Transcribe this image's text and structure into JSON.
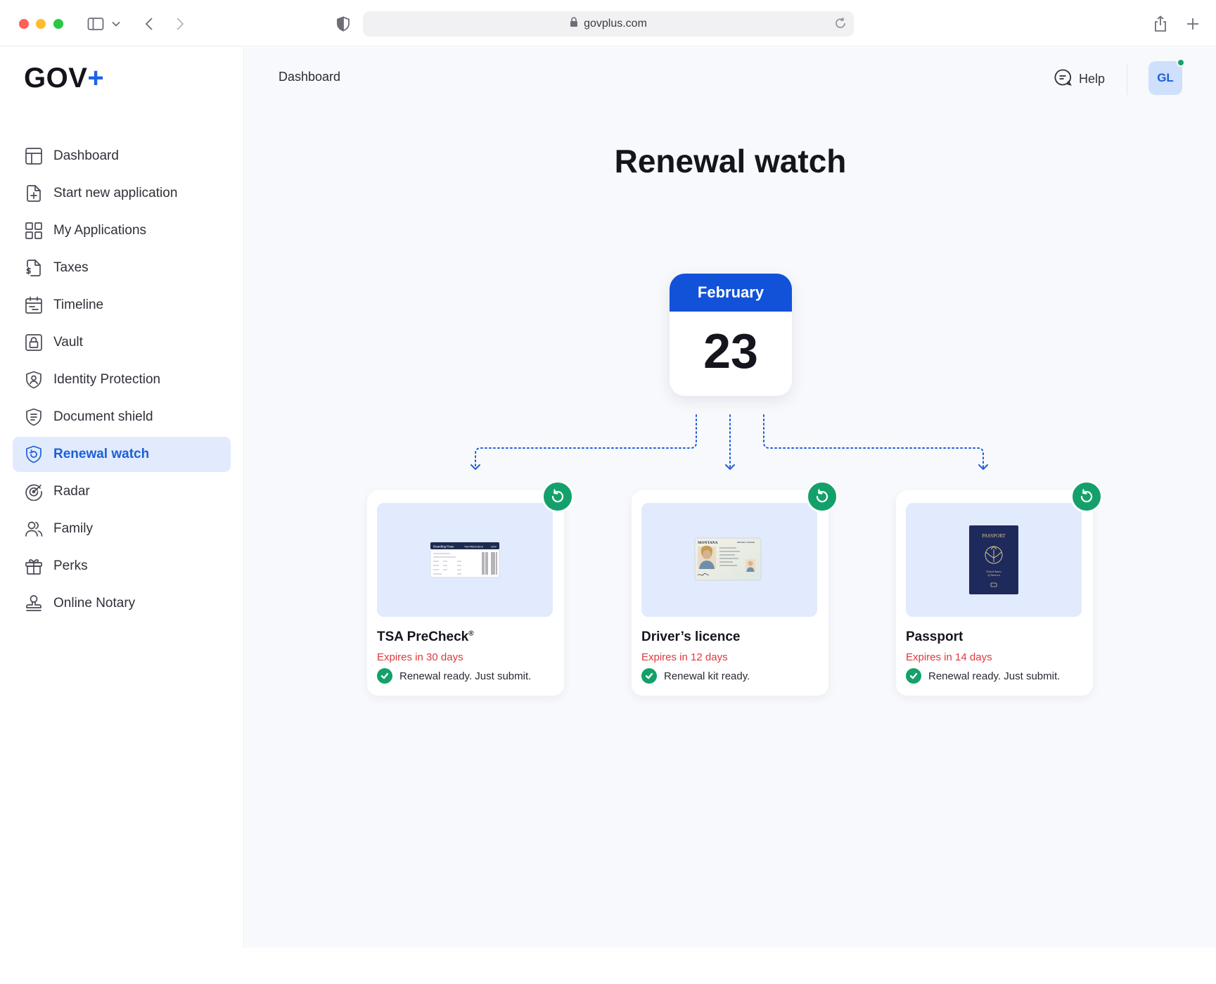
{
  "browser": {
    "url": "govplus.com"
  },
  "sidebar": {
    "logo_text": "GOV",
    "logo_mark": "+",
    "items": [
      {
        "label": "Dashboard",
        "icon": "layout-icon"
      },
      {
        "label": "Start new application",
        "icon": "file-plus-icon"
      },
      {
        "label": "My Applications",
        "icon": "grid-icon"
      },
      {
        "label": "Taxes",
        "icon": "file-dollar-icon"
      },
      {
        "label": "Timeline",
        "icon": "calendar-icon"
      },
      {
        "label": "Vault",
        "icon": "lock-icon"
      },
      {
        "label": "Identity Protection",
        "icon": "shield-user-icon"
      },
      {
        "label": "Document shield",
        "icon": "shield-doc-icon"
      },
      {
        "label": "Renewal watch",
        "icon": "shield-refresh-icon",
        "active": true
      },
      {
        "label": "Radar",
        "icon": "radar-icon"
      },
      {
        "label": "Family",
        "icon": "users-icon"
      },
      {
        "label": "Perks",
        "icon": "gift-icon"
      },
      {
        "label": "Online Notary",
        "icon": "stamp-icon"
      }
    ]
  },
  "topbar": {
    "breadcrumb": "Dashboard",
    "help_label": "Help",
    "avatar_initials": "GL"
  },
  "page": {
    "title": "Renewal watch",
    "calendar": {
      "month": "February",
      "day": "23"
    },
    "cards": [
      {
        "title": "TSA PreCheck",
        "title_mark": "®",
        "expiry": "Expires in 30 days",
        "status": "Renewal ready. Just submit.",
        "image": "boarding-pass-image",
        "pass": {
          "header": "Boarding Pass",
          "brand": "TSA PRECHECK",
          "tag": "GOV"
        }
      },
      {
        "title": "Driver’s licence",
        "expiry": "Expires in 12 days",
        "status": "Renewal kit ready.",
        "image": "drivers-license-image",
        "license": {
          "state": "MONTANA",
          "type": "DRIVER LICENSE"
        }
      },
      {
        "title": "Passport",
        "expiry": "Expires in 14 days",
        "status": "Renewal ready. Just submit.",
        "image": "passport-image",
        "passport": {
          "heading": "PASSPORT",
          "issuer_line1": "United States",
          "issuer_line2": "of America"
        }
      }
    ]
  },
  "colors": {
    "accent": "#1d5fd9",
    "calendar_header": "#1152d9",
    "success": "#14a06a",
    "warning_text": "#e0373b",
    "active_nav_bg": "#e1ebfd"
  }
}
